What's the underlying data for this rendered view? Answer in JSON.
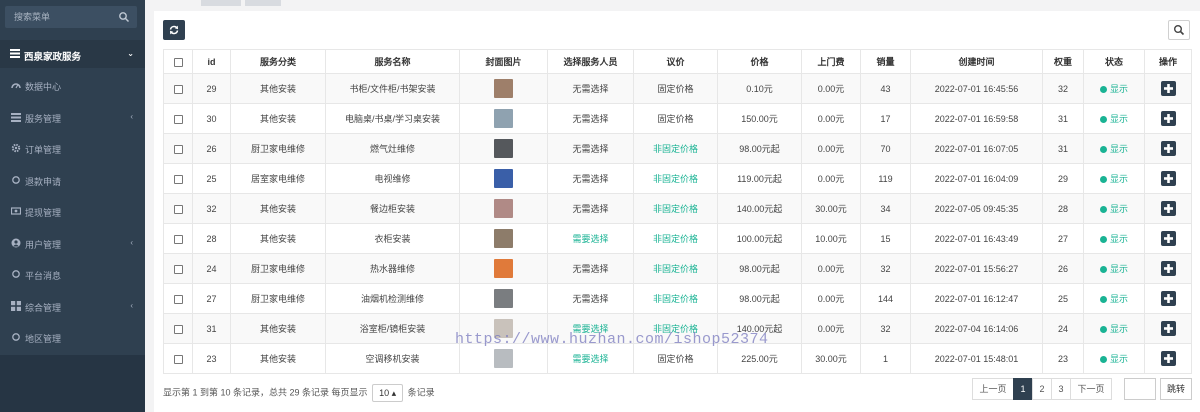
{
  "colors": {
    "sidebar": "#2f4050",
    "accent": "#1ab394",
    "primary_button": "#2f4050"
  },
  "sidebar": {
    "search_placeholder": "搜索菜单",
    "group": {
      "label": "西泉家政服务",
      "icon": "list-icon"
    },
    "items": [
      {
        "label": "数据中心",
        "icon": "dashboard-icon",
        "has_arrow": false
      },
      {
        "label": "服务管理",
        "icon": "list-icon",
        "has_arrow": true
      },
      {
        "label": "订单管理",
        "icon": "gear-icon",
        "has_arrow": false
      },
      {
        "label": "退款申请",
        "icon": "circle-icon",
        "has_arrow": false
      },
      {
        "label": "提现管理",
        "icon": "money-icon",
        "has_arrow": false
      },
      {
        "label": "用户管理",
        "icon": "user-icon",
        "has_arrow": true
      },
      {
        "label": "平台消息",
        "icon": "circle-icon",
        "has_arrow": false
      },
      {
        "label": "综合管理",
        "icon": "grid-icon",
        "has_arrow": true
      },
      {
        "label": "地区管理",
        "icon": "circle-icon",
        "has_arrow": false
      }
    ]
  },
  "toolbar": {
    "refresh_icon": "refresh-icon",
    "search_icon": "search-icon"
  },
  "table": {
    "headers": [
      "id",
      "服务分类",
      "服务名称",
      "封面图片",
      "选择服务人员",
      "议价",
      "价格",
      "上门费",
      "销量",
      "创建时间",
      "权重",
      "状态",
      "操作"
    ],
    "rows": [
      {
        "id": "29",
        "category": "其他安装",
        "name": "书柜/文件柜/书架安装",
        "cover": "#9e7f6a",
        "staff": "无需选择",
        "staff_green": false,
        "pricing": "固定价格",
        "pricing_green": false,
        "price": "0.10元",
        "fee": "0.00元",
        "sales": "43",
        "created": "2022-07-01 16:45:56",
        "weight": "32",
        "status": "显示"
      },
      {
        "id": "30",
        "category": "其他安装",
        "name": "电脑桌/书桌/学习桌安装",
        "cover": "#8fa2b0",
        "staff": "无需选择",
        "staff_green": false,
        "pricing": "固定价格",
        "pricing_green": false,
        "price": "150.00元",
        "fee": "0.00元",
        "sales": "17",
        "created": "2022-07-01 16:59:58",
        "weight": "31",
        "status": "显示"
      },
      {
        "id": "26",
        "category": "厨卫家电维修",
        "name": "燃气灶维修",
        "cover": "#55585c",
        "staff": "无需选择",
        "staff_green": false,
        "pricing": "非固定价格",
        "pricing_green": true,
        "price": "98.00元起",
        "fee": "0.00元",
        "sales": "70",
        "created": "2022-07-01 16:07:05",
        "weight": "31",
        "status": "显示"
      },
      {
        "id": "25",
        "category": "居室家电维修",
        "name": "电视维修",
        "cover": "#3a5fa8",
        "staff": "无需选择",
        "staff_green": false,
        "pricing": "非固定价格",
        "pricing_green": true,
        "price": "119.00元起",
        "fee": "0.00元",
        "sales": "119",
        "created": "2022-07-01 16:04:09",
        "weight": "29",
        "status": "显示"
      },
      {
        "id": "32",
        "category": "其他安装",
        "name": "餐边柜安装",
        "cover": "#b08a86",
        "staff": "无需选择",
        "staff_green": false,
        "pricing": "非固定价格",
        "pricing_green": true,
        "price": "140.00元起",
        "fee": "30.00元",
        "sales": "34",
        "created": "2022-07-05 09:45:35",
        "weight": "28",
        "status": "显示"
      },
      {
        "id": "28",
        "category": "其他安装",
        "name": "衣柜安装",
        "cover": "#8d7c6a",
        "staff": "需要选择",
        "staff_green": true,
        "pricing": "非固定价格",
        "pricing_green": true,
        "price": "100.00元起",
        "fee": "10.00元",
        "sales": "15",
        "created": "2022-07-01 16:43:49",
        "weight": "27",
        "status": "显示"
      },
      {
        "id": "24",
        "category": "厨卫家电维修",
        "name": "热水器维修",
        "cover": "#e07a3a",
        "staff": "无需选择",
        "staff_green": false,
        "pricing": "非固定价格",
        "pricing_green": true,
        "price": "98.00元起",
        "fee": "0.00元",
        "sales": "32",
        "created": "2022-07-01 15:56:27",
        "weight": "26",
        "status": "显示"
      },
      {
        "id": "27",
        "category": "厨卫家电维修",
        "name": "油烟机检测维修",
        "cover": "#7a7d80",
        "staff": "无需选择",
        "staff_green": false,
        "pricing": "非固定价格",
        "pricing_green": true,
        "price": "98.00元起",
        "fee": "0.00元",
        "sales": "144",
        "created": "2022-07-01 16:12:47",
        "weight": "25",
        "status": "显示"
      },
      {
        "id": "31",
        "category": "其他安装",
        "name": "浴室柜/镜柜安装",
        "cover": "#c9c2bb",
        "staff": "需要选择",
        "staff_green": true,
        "pricing": "非固定价格",
        "pricing_green": true,
        "price": "140.00元起",
        "fee": "0.00元",
        "sales": "32",
        "created": "2022-07-04 16:14:06",
        "weight": "24",
        "status": "显示"
      },
      {
        "id": "23",
        "category": "其他安装",
        "name": "空调移机安装",
        "cover": "#b8bcc0",
        "staff": "需要选择",
        "staff_green": true,
        "pricing": "固定价格",
        "pricing_green": false,
        "price": "225.00元",
        "fee": "30.00元",
        "sales": "1",
        "created": "2022-07-01 15:48:01",
        "weight": "23",
        "status": "显示"
      }
    ]
  },
  "footer": {
    "info_prefix": "显示第 1 到第 10 条记录，总共 29 条记录 每页显示",
    "page_size": "10",
    "info_suffix": "条记录",
    "pages": [
      "上一页",
      "1",
      "2",
      "3",
      "下一页"
    ],
    "active_page": "1",
    "jump_label": "跳转"
  },
  "watermark": "https://www.huzhan.com/ishop52374"
}
